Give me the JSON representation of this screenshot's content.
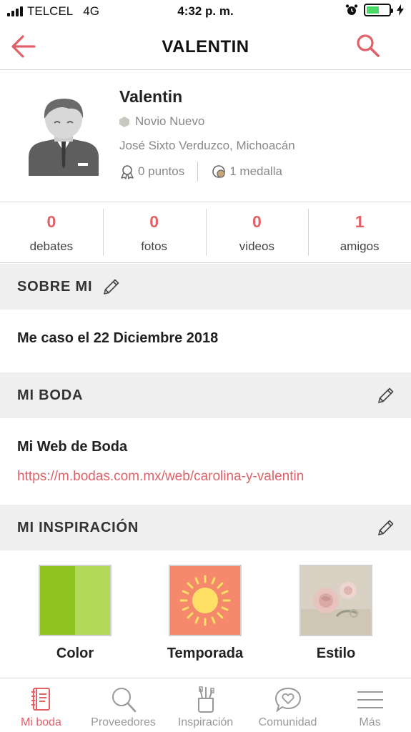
{
  "status_bar": {
    "carrier": "TELCEL",
    "network": "4G",
    "time": "4:32 p. m."
  },
  "nav": {
    "title": "VALENTIN"
  },
  "profile": {
    "name": "Valentin",
    "rank": "Novio Nuevo",
    "location": "José Sixto Verduzco, Michoacán",
    "points": "0 puntos",
    "medals": "1 medalla"
  },
  "counters": [
    {
      "value": "0",
      "label": "debates"
    },
    {
      "value": "0",
      "label": "fotos"
    },
    {
      "value": "0",
      "label": "videos"
    },
    {
      "value": "1",
      "label": "amigos"
    }
  ],
  "sections": {
    "about": {
      "title": "SOBRE MI",
      "text": "Me caso el 22 Diciembre 2018"
    },
    "wedding": {
      "title": "MI BODA",
      "web_title": "Mi Web de Boda",
      "link": "https://m.bodas.com.mx/web/carolina-y-valentin"
    },
    "inspiration": {
      "title": "MI INSPIRACIÓN",
      "items": [
        {
          "label": "Color"
        },
        {
          "label": "Temporada"
        },
        {
          "label": "Estilo"
        }
      ]
    }
  },
  "tabs": [
    {
      "label": "Mi boda",
      "icon": "notebook-icon",
      "active": true
    },
    {
      "label": "Proveedores",
      "icon": "search-icon"
    },
    {
      "label": "Inspiración",
      "icon": "brush-cup-icon"
    },
    {
      "label": "Comunidad",
      "icon": "chat-heart-icon"
    },
    {
      "label": "Más",
      "icon": "menu-icon"
    }
  ],
  "colors": {
    "accent": "#e06167",
    "header_bg": "#efefef",
    "battery": "#4cd964"
  }
}
